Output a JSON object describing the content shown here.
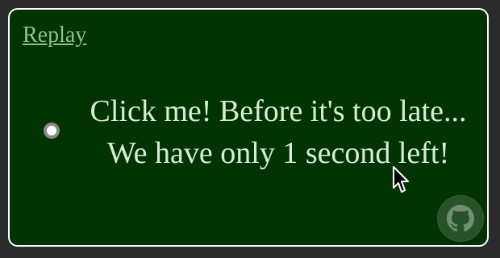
{
  "replay_label": "Replay",
  "message": {
    "line1": "Click me! Before it's too late...",
    "line2": "We have only 1 second left!"
  },
  "icons": {
    "radio": "radio-button-icon",
    "github": "github-icon",
    "cursor": "mouse-cursor-icon"
  },
  "colors": {
    "background": "#023302",
    "text": "#d7ecd7",
    "link": "#8fbf8f"
  }
}
